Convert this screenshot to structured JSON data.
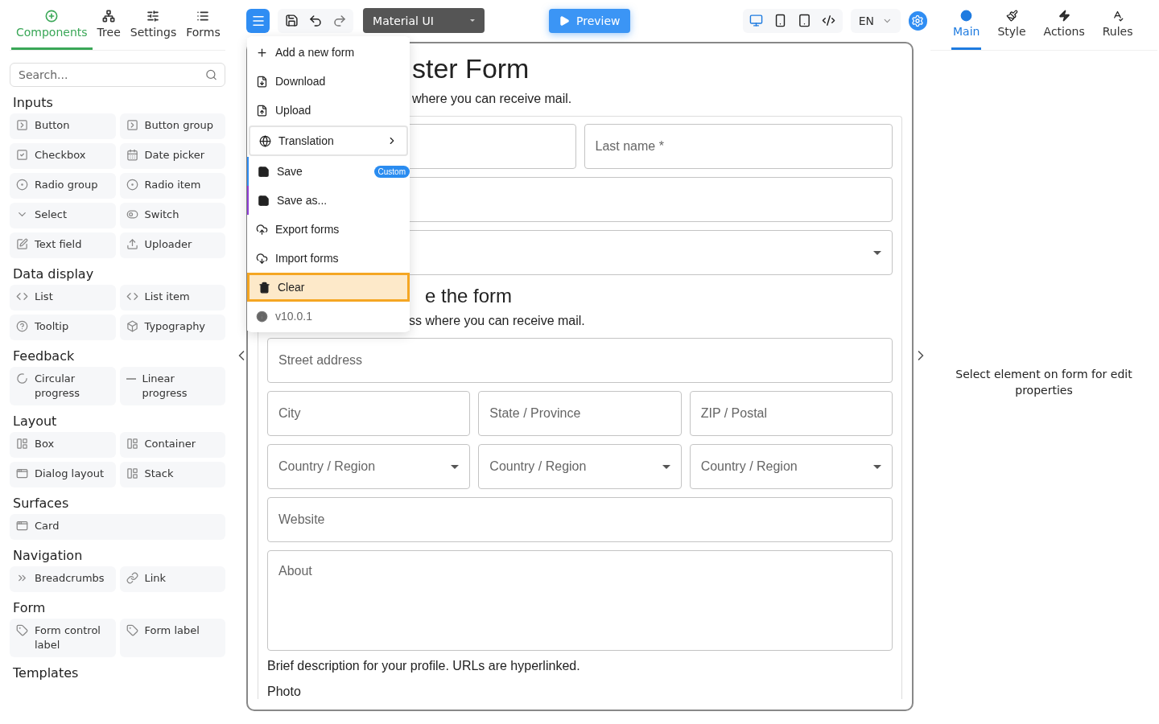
{
  "sidebar": {
    "tabs": [
      {
        "label": "Components",
        "selected": true
      },
      {
        "label": "Tree",
        "selected": false
      },
      {
        "label": "Settings",
        "selected": false
      },
      {
        "label": "Forms",
        "selected": false
      }
    ],
    "search": {
      "placeholder": "Search..."
    },
    "sections": [
      {
        "title": "Inputs",
        "items": [
          {
            "label": "Button",
            "kind": "button"
          },
          {
            "label": "Button group",
            "kind": "button"
          },
          {
            "label": "Checkbox",
            "kind": "checkbox"
          },
          {
            "label": "Date picker",
            "kind": "date"
          },
          {
            "label": "Radio group",
            "kind": "radio"
          },
          {
            "label": "Radio item",
            "kind": "radio"
          },
          {
            "label": "Select",
            "kind": "select"
          },
          {
            "label": "Switch",
            "kind": "switch"
          },
          {
            "label": "Text field",
            "kind": "text"
          },
          {
            "label": "Uploader",
            "kind": "upload"
          }
        ]
      },
      {
        "title": "Data display",
        "items": [
          {
            "label": "List",
            "kind": "list"
          },
          {
            "label": "List item",
            "kind": "list"
          },
          {
            "label": "Tooltip",
            "kind": "tooltip"
          },
          {
            "label": "Typography",
            "kind": "typography"
          }
        ]
      },
      {
        "title": "Feedback",
        "items": [
          {
            "label": "Circular progress",
            "kind": "circular"
          },
          {
            "label": "Linear progress",
            "kind": "linear"
          }
        ]
      },
      {
        "title": "Layout",
        "items": [
          {
            "label": "Box",
            "kind": "layout"
          },
          {
            "label": "Container",
            "kind": "layout"
          },
          {
            "label": "Dialog layout",
            "kind": "dialog"
          },
          {
            "label": "Stack",
            "kind": "layout"
          }
        ]
      },
      {
        "title": "Surfaces",
        "items": [
          {
            "label": "Card",
            "kind": "dialog"
          }
        ]
      },
      {
        "title": "Navigation",
        "items": [
          {
            "label": "Breadcrumbs",
            "kind": "breadcrumbs"
          },
          {
            "label": "Link",
            "kind": "link"
          }
        ]
      },
      {
        "title": "Form",
        "items": [
          {
            "label": "Form control label",
            "kind": "label"
          },
          {
            "label": "Form label",
            "kind": "label"
          }
        ]
      },
      {
        "title": "Templates"
      }
    ]
  },
  "toolbar": {
    "library": "Material UI",
    "preview": "Preview",
    "language": "EN",
    "devices": [
      {
        "kind": "desktop",
        "selected": true
      },
      {
        "kind": "phone",
        "selected": false
      },
      {
        "kind": "tablet",
        "selected": false
      },
      {
        "kind": "code",
        "selected": false
      }
    ]
  },
  "menu": {
    "items": [
      {
        "label": "Add a new form",
        "kind": "add",
        "selected": false
      },
      {
        "label": "Download",
        "kind": "download",
        "selected": false
      },
      {
        "label": "Upload",
        "kind": "upload",
        "selected": false
      },
      {
        "label": "Translation",
        "kind": "submenu",
        "selected": false
      },
      {
        "label": "Save",
        "kind": "save",
        "badge": "Custom",
        "color": "#2f8df3",
        "selected": false
      },
      {
        "label": "Save as...",
        "kind": "save",
        "color": "#8e3fd6",
        "selected": false
      },
      {
        "label": "Export forms",
        "kind": "export",
        "selected": false
      },
      {
        "label": "Import forms",
        "kind": "import",
        "selected": false
      },
      {
        "label": "Clear",
        "kind": "clear",
        "selected": true
      },
      {
        "label": "v10.0.1",
        "kind": "version",
        "selected": false
      }
    ]
  },
  "form": {
    "title": "ster Form",
    "subtitle": "where you can receive mail.",
    "rows_top": [
      {
        "fields": [
          {
            "kind": "text"
          },
          {
            "kind": "text",
            "placeholder": "Last name *"
          }
        ]
      },
      {
        "fields": [
          {
            "kind": "text"
          }
        ]
      },
      {
        "fields": [
          {
            "kind": "select"
          }
        ]
      }
    ],
    "section_title": "e the form",
    "section_subtitle": "ss where you can receive mail.",
    "rows": [
      {
        "fields": [
          {
            "kind": "text",
            "placeholder": "Street address"
          }
        ]
      },
      {
        "fields": [
          {
            "kind": "text",
            "placeholder": "City"
          },
          {
            "kind": "text",
            "placeholder": "State / Province"
          },
          {
            "kind": "text",
            "placeholder": "ZIP / Postal"
          }
        ]
      },
      {
        "fields": [
          {
            "kind": "select",
            "placeholder": "Country / Region"
          },
          {
            "kind": "select",
            "placeholder": "Country / Region"
          },
          {
            "kind": "select",
            "placeholder": "Country / Region"
          }
        ]
      },
      {
        "fields": [
          {
            "kind": "text",
            "placeholder": "Website"
          }
        ]
      },
      {
        "fields": [
          {
            "kind": "textarea",
            "placeholder": "About"
          }
        ]
      }
    ],
    "helper": "Brief description for your profile. URLs are hyperlinked.",
    "next_label": "Photo"
  },
  "properties": {
    "tabs": [
      {
        "label": "Main",
        "selected": true
      },
      {
        "label": "Style",
        "selected": false
      },
      {
        "label": "Actions",
        "selected": false
      },
      {
        "label": "Rules",
        "selected": false
      }
    ],
    "message": "Select element on form for edit properties"
  }
}
